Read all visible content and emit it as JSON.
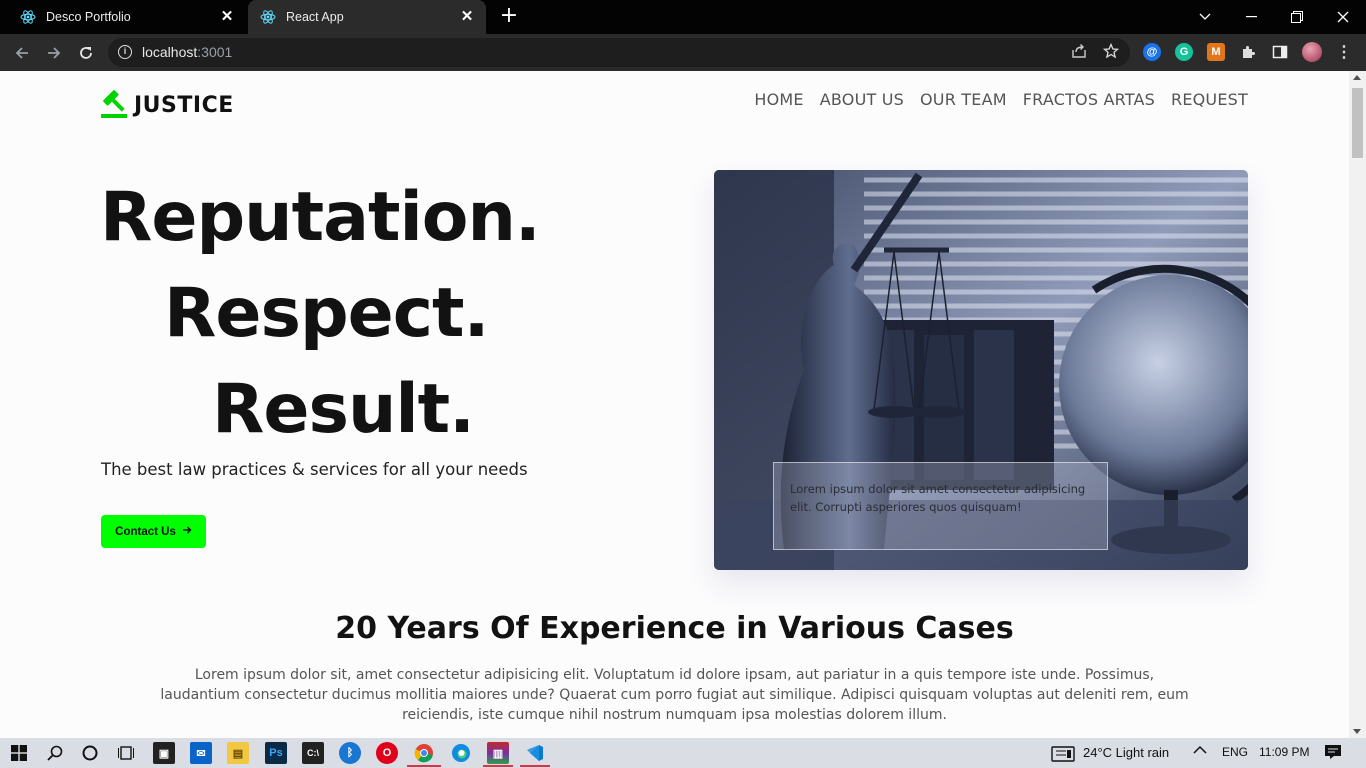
{
  "browser": {
    "tabs": [
      {
        "title": "Desco Portfolio",
        "active": false
      },
      {
        "title": "React App",
        "active": true
      }
    ],
    "url_host": "localhost",
    "url_port": ":3001"
  },
  "site": {
    "brand": "JUSTICE",
    "nav": [
      "HOME",
      "ABOUT US",
      "OUR TEAM",
      "FRACTOS ARTAS",
      "REQUEST"
    ],
    "hero": {
      "lines": [
        "Reputation.",
        "Respect.",
        "Result."
      ],
      "subtitle": "The best law practices & services for all your needs",
      "cta": "Contact Us",
      "image_caption": "Lorem ipsum dolor sit amet consectetur adipisicing elit. Corrupti asperiores quos quisquam!"
    },
    "section": {
      "title": "20 Years Of Experience in Various Cases",
      "body": "Lorem ipsum dolor sit, amet consectetur adipisicing elit. Voluptatum id dolore ipsam, aut pariatur in a quis tempore iste unde. Possimus, laudantium consectetur ducimus mollitia maiores unde? Quaerat cum porro fugiat aut similique. Adipisci quisquam voluptas aut deleniti rem, eum reiciendis, iste cumque nihil nostrum numquam ipsa molestias dolorem illum."
    },
    "accent_color": "#00ff00"
  },
  "taskbar": {
    "weather": "24°C  Light rain",
    "language": "ENG",
    "time": "11:09 PM"
  }
}
